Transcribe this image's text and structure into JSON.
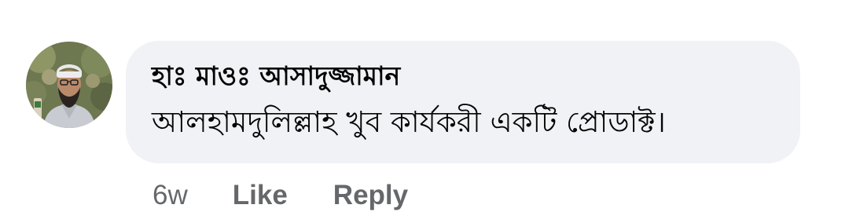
{
  "comment": {
    "author": "হাঃ মাওঃ আসাদুজ্জামান",
    "text": "আলহামদুলিল্লাহ খুব কার্যকরী একটি প্রোডাক্ট।",
    "timestamp": "6w",
    "like_label": "Like",
    "reply_label": "Reply"
  },
  "avatar": {
    "icon": "user-profile-photo-icon"
  },
  "colors": {
    "bubble_background": "#f0f2f5",
    "text_primary": "#050505",
    "text_secondary": "#65676b"
  }
}
